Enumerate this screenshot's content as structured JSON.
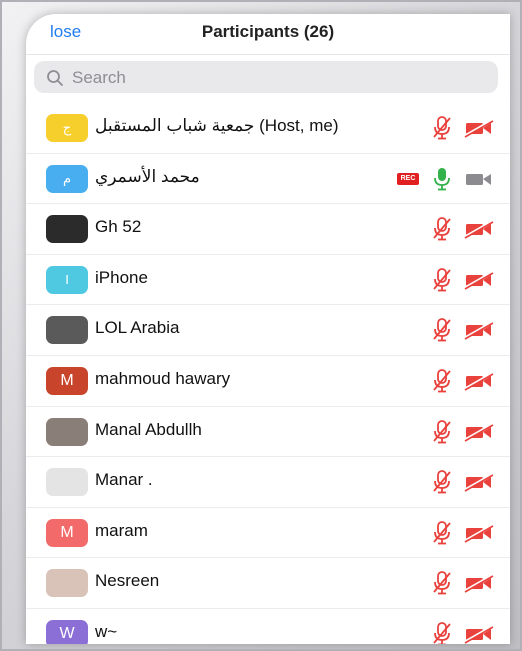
{
  "header": {
    "close_label": "lose",
    "title": "Participants (26)"
  },
  "search": {
    "placeholder": "Search"
  },
  "colors": {
    "accent": "#1f7cf2",
    "muted_red": "#e9413c",
    "mic_green": "#33b24b",
    "rec_red": "#e02020"
  },
  "participants": [
    {
      "name": "جمعية شباب المستقبل (Host, me)",
      "avatar_text": "ج",
      "avatar_color": "#f6cf2c",
      "mic": "muted",
      "video": "off",
      "rec": false
    },
    {
      "name": "محمد الأسمري",
      "avatar_text": "م",
      "avatar_color": "#49aef0",
      "mic": "on",
      "video": "on",
      "rec": true,
      "rec_label": "REC"
    },
    {
      "name": "Gh 52",
      "avatar_text": "",
      "avatar_color": "#2b2b2b",
      "mic": "muted",
      "video": "off",
      "rec": false
    },
    {
      "name": "iPhone",
      "avatar_text": "I",
      "avatar_color": "#4fc9e2",
      "mic": "muted",
      "video": "off",
      "rec": false
    },
    {
      "name": "LOL Arabia",
      "avatar_text": "",
      "avatar_color": "#5a5a5a",
      "mic": "muted",
      "video": "off",
      "rec": false
    },
    {
      "name": "mahmoud hawary",
      "avatar_text": "M",
      "avatar_color": "#c8442a",
      "mic": "muted",
      "video": "off",
      "rec": false
    },
    {
      "name": "Manal Abdullh",
      "avatar_text": "",
      "avatar_color": "#8a7f78",
      "mic": "muted",
      "video": "off",
      "rec": false
    },
    {
      "name": "Manar .",
      "avatar_text": "",
      "avatar_color": "#e4e4e4",
      "mic": "muted",
      "video": "off",
      "rec": false
    },
    {
      "name": "maram",
      "avatar_text": "M",
      "avatar_color": "#f26a6a",
      "mic": "muted",
      "video": "off",
      "rec": false
    },
    {
      "name": "Nesreen",
      "avatar_text": "",
      "avatar_color": "#d9c2b8",
      "mic": "muted",
      "video": "off",
      "rec": false
    },
    {
      "name": "w~",
      "avatar_text": "W",
      "avatar_color": "#8b6fd6",
      "mic": "muted",
      "video": "off",
      "rec": false
    }
  ]
}
